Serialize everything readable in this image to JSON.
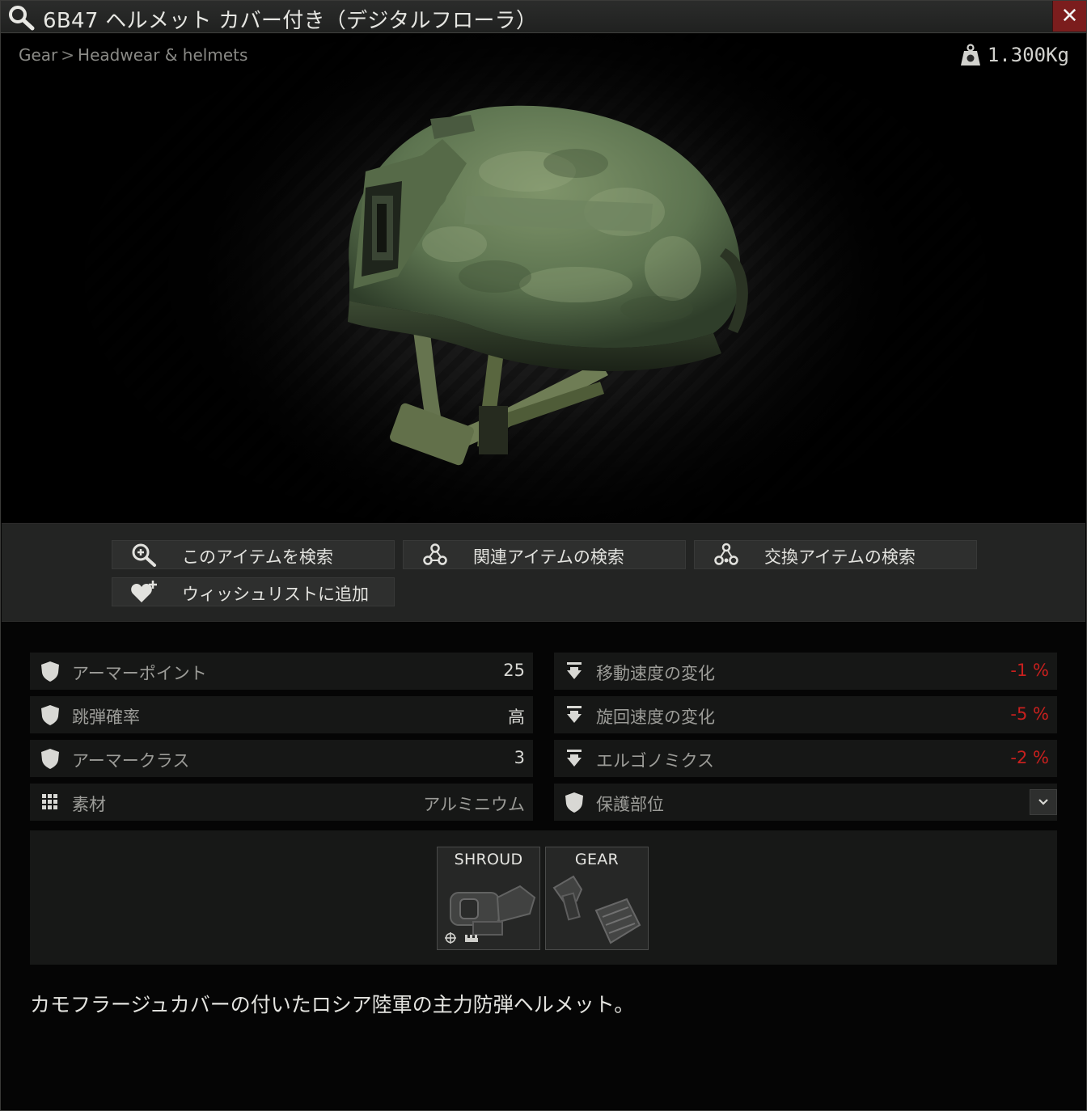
{
  "window": {
    "title": "6B47 ヘルメット カバー付き（デジタルフローラ）",
    "close_label": "✕"
  },
  "breadcrumb": {
    "category": "Gear",
    "separator": ">",
    "subcategory": "Headwear & helmets"
  },
  "weight": {
    "value": "1.300Kg",
    "icon": "weight-icon"
  },
  "actions": [
    {
      "label": "このアイテムを検索",
      "icon": "search-plus-icon"
    },
    {
      "label": "関連アイテムの検索",
      "icon": "link-nodes-icon"
    },
    {
      "label": "交換アイテムの検索",
      "icon": "barter-nodes-icon"
    },
    {
      "label": "ウィッシュリストに追加",
      "icon": "heart-plus-icon"
    }
  ],
  "stats_left": [
    {
      "name": "アーマーポイント",
      "value": "25",
      "icon": "shield-icon"
    },
    {
      "name": "跳弾確率",
      "value": "高",
      "icon": "shield-icon"
    },
    {
      "name": "アーマークラス",
      "value": "3",
      "icon": "shield-icon"
    },
    {
      "name": "素材",
      "value": "アルミニウム",
      "icon": "grid-icon"
    }
  ],
  "stats_right": [
    {
      "name": "移動速度の変化",
      "value": "-1 %",
      "icon": "weight-down-icon"
    },
    {
      "name": "旋回速度の変化",
      "value": "-5 %",
      "icon": "weight-down-icon"
    },
    {
      "name": "エルゴノミクス",
      "value": "-2 %",
      "icon": "weight-down-icon"
    },
    {
      "name": "保護部位",
      "value": "",
      "icon": "shield-icon"
    }
  ],
  "slots": [
    {
      "label": "SHROUD"
    },
    {
      "label": "GEAR"
    }
  ],
  "description": "カモフラージュカバーの付いたロシア陸軍の主力防弾ヘルメット。",
  "colors": {
    "negative": "#c8201e",
    "close_button": "#7b1d1d",
    "background": "#050505"
  }
}
